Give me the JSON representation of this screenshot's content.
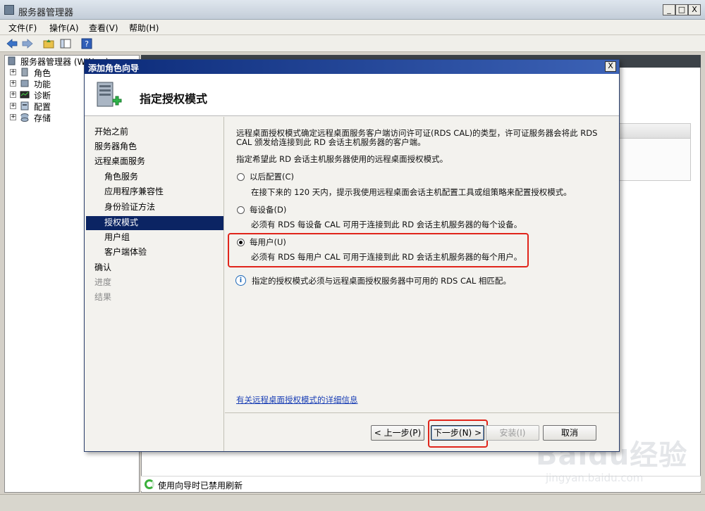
{
  "window": {
    "title": "服务器管理器",
    "min": "_",
    "max": "□",
    "close": "X"
  },
  "menu": [
    "文件(F)",
    "操作(A)",
    "查看(V)",
    "帮助(H)"
  ],
  "tree": {
    "root": "服务器管理器 (WIN-...)",
    "items": [
      "角色",
      "功能",
      "诊断",
      "配置",
      "存储"
    ]
  },
  "status_line": "使用向导时已禁用刷新",
  "dialog": {
    "title": "添加角色向导",
    "close": "X",
    "header_title": "指定授权模式",
    "nav": [
      {
        "label": "开始之前",
        "level": 0,
        "state": "normal"
      },
      {
        "label": "服务器角色",
        "level": 0,
        "state": "normal"
      },
      {
        "label": "远程桌面服务",
        "level": 0,
        "state": "normal"
      },
      {
        "label": "角色服务",
        "level": 1,
        "state": "normal"
      },
      {
        "label": "应用程序兼容性",
        "level": 1,
        "state": "normal"
      },
      {
        "label": "身份验证方法",
        "level": 1,
        "state": "normal"
      },
      {
        "label": "授权模式",
        "level": 1,
        "state": "selected"
      },
      {
        "label": "用户组",
        "level": 1,
        "state": "normal"
      },
      {
        "label": "客户端体验",
        "level": 1,
        "state": "normal"
      },
      {
        "label": "确认",
        "level": 0,
        "state": "normal"
      },
      {
        "label": "进度",
        "level": 0,
        "state": "disabled"
      },
      {
        "label": "结果",
        "level": 0,
        "state": "disabled"
      }
    ],
    "intro_line1": "远程桌面授权模式确定远程桌面服务客户端访问许可证(RDS CAL)的类型，许可证服务器会将此 RDS",
    "intro_line2": "CAL 颁发给连接到此 RD 会话主机服务器的客户端。",
    "prompt": "指定希望此 RD 会话主机服务器使用的远程桌面授权模式。",
    "options": [
      {
        "label": "以后配置(C)",
        "desc": "在接下来的 120 天内，提示我使用远程桌面会话主机配置工具或组策略来配置授权模式。",
        "checked": false
      },
      {
        "label": "每设备(D)",
        "desc": "必须有 RDS 每设备 CAL 可用于连接到此 RD 会话主机服务器的每个设备。",
        "checked": false
      },
      {
        "label": "每用户(U)",
        "desc": "必须有 RDS 每用户 CAL 可用于连接到此 RD 会话主机服务器的每个用户。",
        "checked": true
      }
    ],
    "info_text": "指定的授权模式必须与远程桌面授权服务器中可用的 RDS CAL 相匹配。",
    "detail_link": "有关远程桌面授权模式的详细信息",
    "buttons": {
      "back": "< 上一步(P)",
      "next": "下一步(N) >",
      "install": "安装(I)",
      "cancel": "取消"
    }
  },
  "watermark": {
    "logo": "Baidu经验",
    "url": "jingyan.baidu.com"
  },
  "colors": {
    "dialog_title_start": "#0b2a78",
    "nav_selected": "#0b2463",
    "highlight": "#e0251b",
    "link": "#1a3fb5"
  }
}
